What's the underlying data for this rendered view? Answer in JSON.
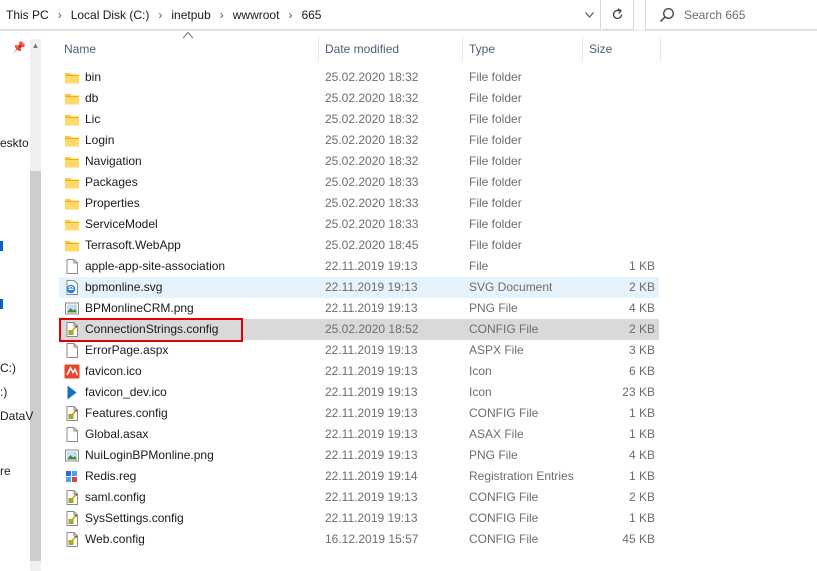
{
  "address": {
    "breadcrumbs": [
      "This PC",
      "Local Disk (C:)",
      "inetpub",
      "wwwroot",
      "665"
    ],
    "separator": "›"
  },
  "search": {
    "placeholder": "Search 665"
  },
  "nav_fragments": [
    "eskto",
    "C:)",
    ":)",
    "DataV",
    "re"
  ],
  "columns": {
    "name": "Name",
    "date": "Date modified",
    "type": "Type",
    "size": "Size"
  },
  "files": [
    {
      "name": "bin",
      "date": "25.02.2020 18:32",
      "type": "File folder",
      "size": "",
      "icon": "folder-icon",
      "state": ""
    },
    {
      "name": "db",
      "date": "25.02.2020 18:32",
      "type": "File folder",
      "size": "",
      "icon": "folder-icon",
      "state": ""
    },
    {
      "name": "Lic",
      "date": "25.02.2020 18:32",
      "type": "File folder",
      "size": "",
      "icon": "folder-icon",
      "state": ""
    },
    {
      "name": "Login",
      "date": "25.02.2020 18:32",
      "type": "File folder",
      "size": "",
      "icon": "folder-icon",
      "state": ""
    },
    {
      "name": "Navigation",
      "date": "25.02.2020 18:32",
      "type": "File folder",
      "size": "",
      "icon": "folder-icon",
      "state": ""
    },
    {
      "name": "Packages",
      "date": "25.02.2020 18:33",
      "type": "File folder",
      "size": "",
      "icon": "folder-icon",
      "state": ""
    },
    {
      "name": "Properties",
      "date": "25.02.2020 18:33",
      "type": "File folder",
      "size": "",
      "icon": "folder-icon",
      "state": ""
    },
    {
      "name": "ServiceModel",
      "date": "25.02.2020 18:33",
      "type": "File folder",
      "size": "",
      "icon": "folder-icon",
      "state": ""
    },
    {
      "name": "Terrasoft.WebApp",
      "date": "25.02.2020 18:45",
      "type": "File folder",
      "size": "",
      "icon": "folder-icon",
      "state": ""
    },
    {
      "name": "apple-app-site-association",
      "date": "22.11.2019 19:13",
      "type": "File",
      "size": "1 KB",
      "icon": "file-icon",
      "state": ""
    },
    {
      "name": "bpmonline.svg",
      "date": "22.11.2019 19:13",
      "type": "SVG Document",
      "size": "2 KB",
      "icon": "edge-svg-icon",
      "state": "hover"
    },
    {
      "name": "BPMonlineCRM.png",
      "date": "22.11.2019 19:13",
      "type": "PNG File",
      "size": "4 KB",
      "icon": "image-icon",
      "state": ""
    },
    {
      "name": "ConnectionStrings.config",
      "date": "25.02.2020 18:52",
      "type": "CONFIG File",
      "size": "2 KB",
      "icon": "config-icon",
      "state": "selected"
    },
    {
      "name": "ErrorPage.aspx",
      "date": "22.11.2019 19:13",
      "type": "ASPX File",
      "size": "3 KB",
      "icon": "file-icon",
      "state": ""
    },
    {
      "name": "favicon.ico",
      "date": "22.11.2019 19:13",
      "type": "Icon",
      "size": "6 KB",
      "icon": "favicon-icon",
      "state": ""
    },
    {
      "name": "favicon_dev.ico",
      "date": "22.11.2019 19:13",
      "type": "Icon",
      "size": "23 KB",
      "icon": "favicon-dev-icon",
      "state": ""
    },
    {
      "name": "Features.config",
      "date": "22.11.2019 19:13",
      "type": "CONFIG File",
      "size": "1 KB",
      "icon": "config-icon",
      "state": ""
    },
    {
      "name": "Global.asax",
      "date": "22.11.2019 19:13",
      "type": "ASAX File",
      "size": "1 KB",
      "icon": "file-icon",
      "state": ""
    },
    {
      "name": "NuiLoginBPMonline.png",
      "date": "22.11.2019 19:13",
      "type": "PNG File",
      "size": "4 KB",
      "icon": "image-icon",
      "state": ""
    },
    {
      "name": "Redis.reg",
      "date": "22.11.2019 19:14",
      "type": "Registration Entries",
      "size": "1 KB",
      "icon": "registry-icon",
      "state": ""
    },
    {
      "name": "saml.config",
      "date": "22.11.2019 19:13",
      "type": "CONFIG File",
      "size": "2 KB",
      "icon": "config-icon",
      "state": ""
    },
    {
      "name": "SysSettings.config",
      "date": "22.11.2019 19:13",
      "type": "CONFIG File",
      "size": "1 KB",
      "icon": "config-icon",
      "state": ""
    },
    {
      "name": "Web.config",
      "date": "16.12.2019 15:57",
      "type": "CONFIG File",
      "size": "45 KB",
      "icon": "config-icon",
      "state": ""
    }
  ],
  "colors": {
    "selected": "#d9d9d9",
    "hover": "#e5f3ff",
    "highlight": "#e00000",
    "folder": "#ffc83d"
  }
}
